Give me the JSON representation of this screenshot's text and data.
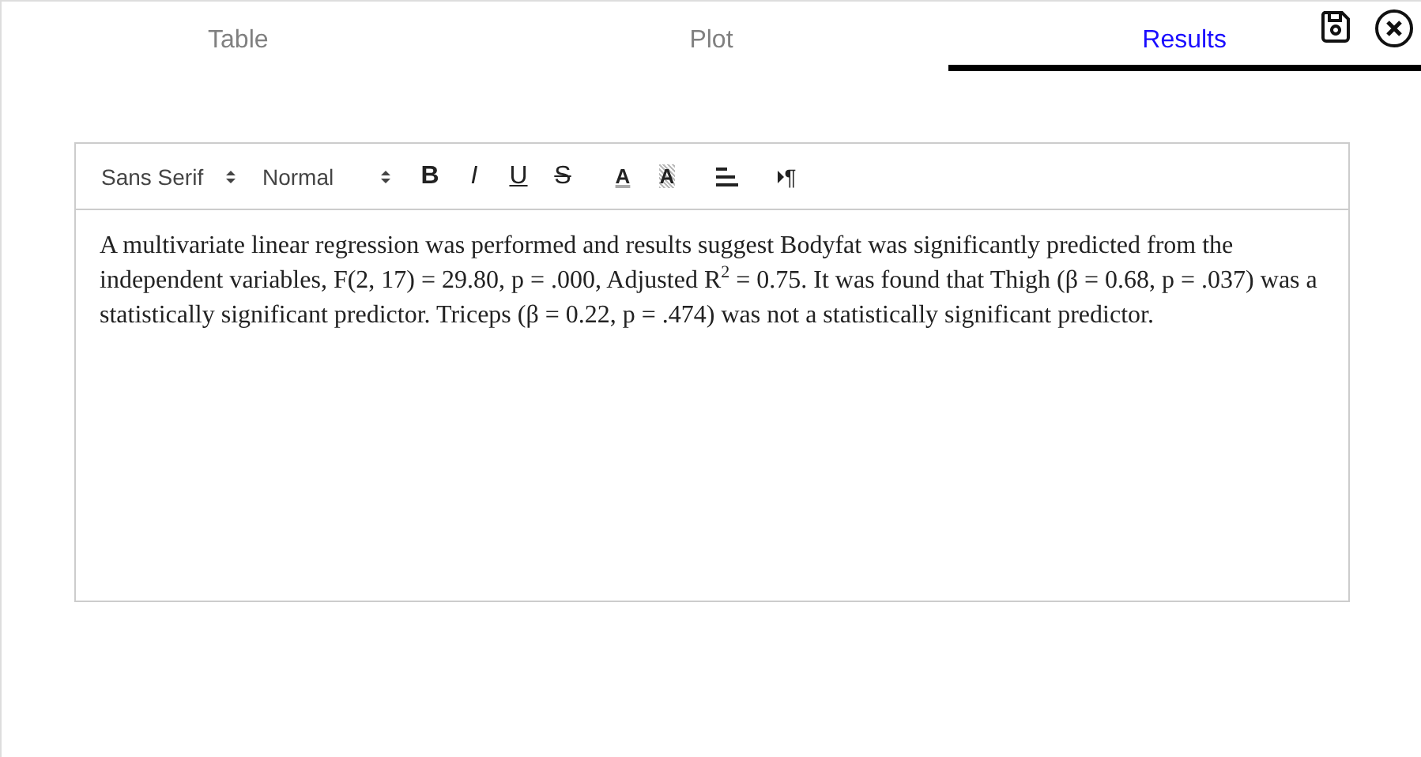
{
  "tabs": [
    {
      "label": "Table",
      "selected": false
    },
    {
      "label": "Plot",
      "selected": false
    },
    {
      "label": "Results",
      "selected": true
    }
  ],
  "toolbar": {
    "font": "Sans Serif",
    "size": "Normal",
    "buttons": [
      {
        "kind": "bold",
        "label": "B"
      },
      {
        "kind": "italic",
        "label": "I"
      },
      {
        "kind": "underline",
        "label": "U"
      },
      {
        "kind": "strike",
        "label": "S"
      },
      {
        "kind": "color",
        "label": "A"
      },
      {
        "kind": "background",
        "label": "A"
      },
      {
        "kind": "align"
      },
      {
        "kind": "direction",
        "label": "¶"
      }
    ]
  },
  "editor": {
    "text": "A multivariate linear regression was performed and results suggest Bodyfat was significantly predicted from the independent variables, F(2, 17) = 29.80, p = .000, Adjusted R$^{2}$ = 0.75. It was found that Thigh (β = 0.68, p = .037) was a statistically significant predictor. Triceps (β = 0.22, p = .474) was not a statistically significant predictor."
  }
}
